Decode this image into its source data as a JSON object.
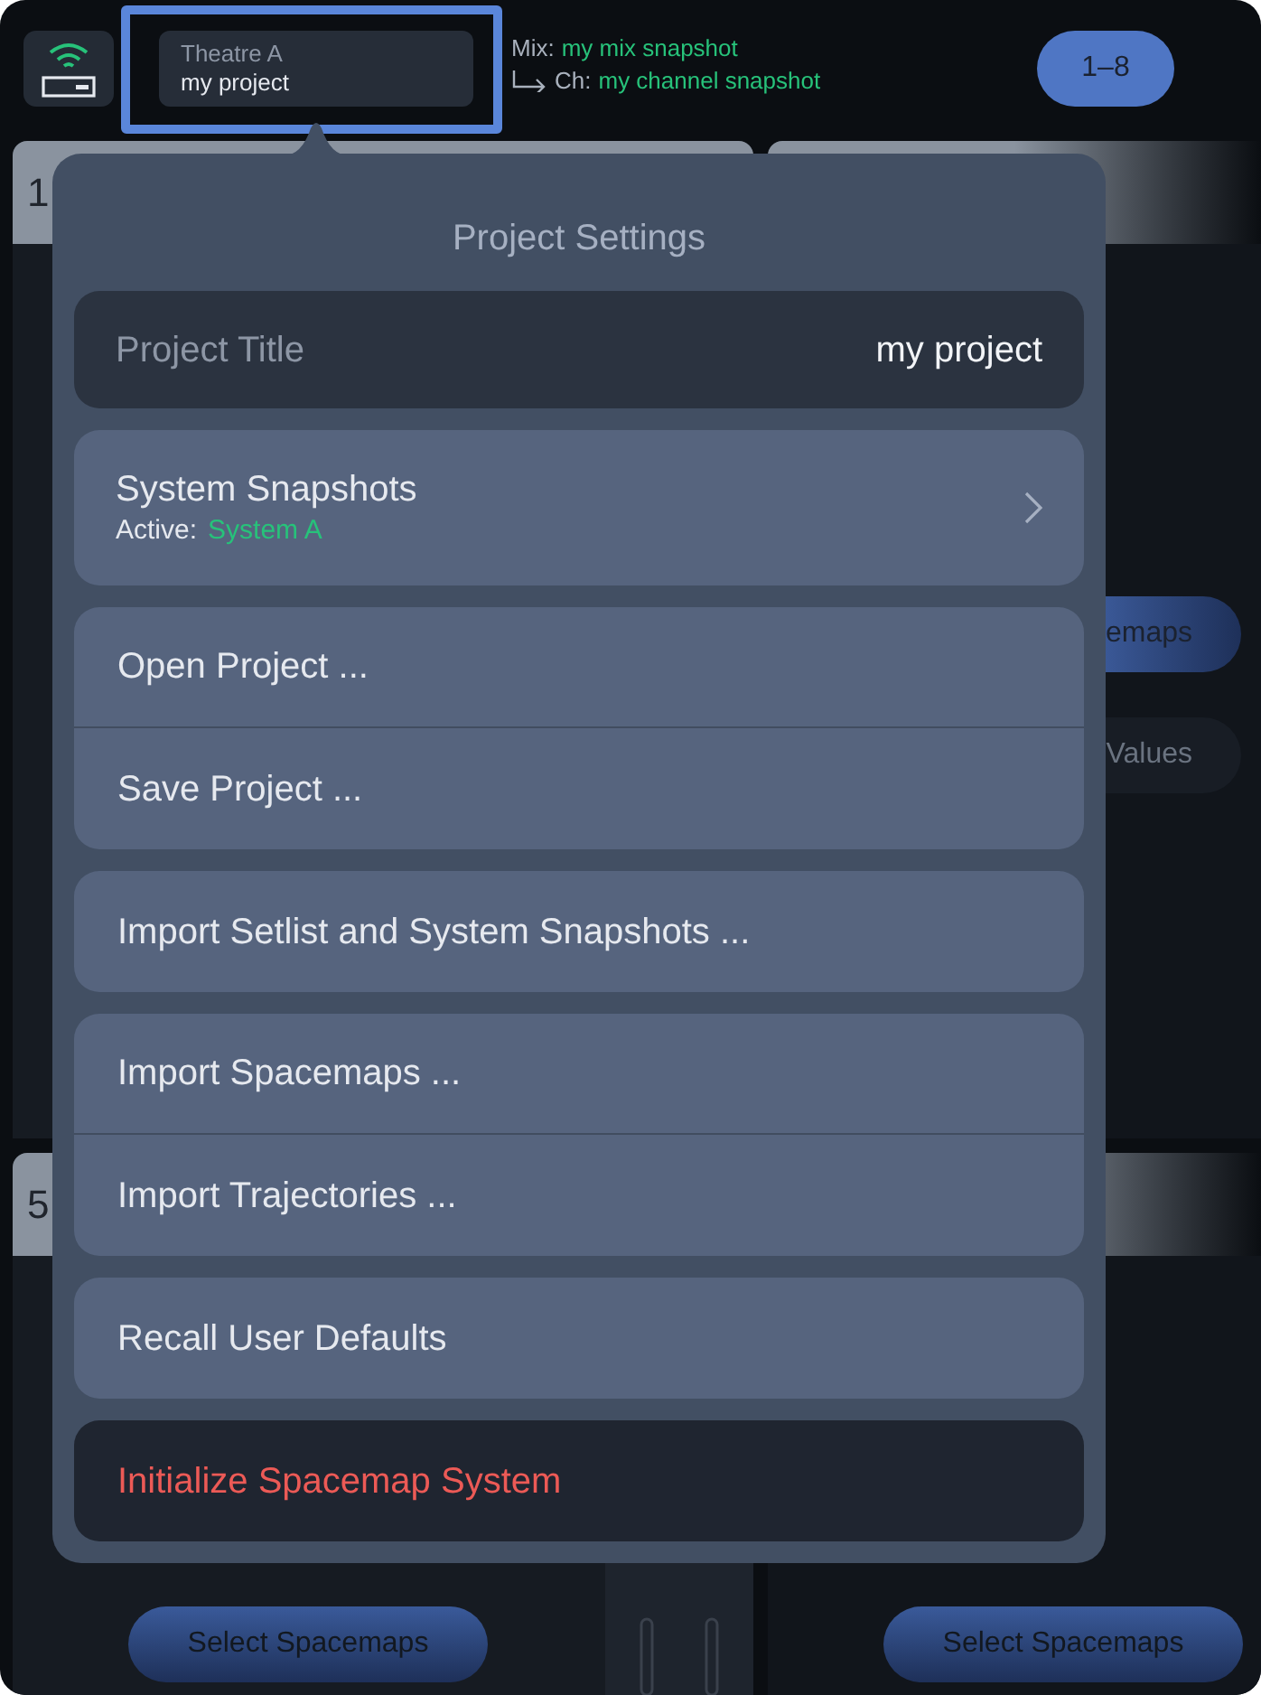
{
  "top_bar": {
    "device_name": "Theatre A",
    "project_name": "my project",
    "mix_label": "Mix:",
    "mix_snapshot": "my mix snapshot",
    "channel_label": "Ch:",
    "channel_snapshot": "my channel snapshot",
    "bank_button": "1–8"
  },
  "background": {
    "upper_panel_label": "1",
    "lower_panel_label": "5",
    "side_buttons": [
      {
        "label": "emaps",
        "selected": true
      },
      {
        "label": "Values",
        "selected": false
      }
    ],
    "bottom_buttons": [
      "Select Spacemaps",
      "Select Spacemaps"
    ]
  },
  "popover": {
    "title": "Project Settings",
    "project_title": {
      "label": "Project Title",
      "value": "my project"
    },
    "groups": [
      {
        "items": [
          {
            "kind": "nav",
            "label": "System Snapshots",
            "sublabel": "Active:",
            "subvalue": "System A"
          }
        ]
      },
      {
        "items": [
          {
            "kind": "action",
            "label": "Open Project ..."
          },
          {
            "kind": "action",
            "label": "Save Project ..."
          }
        ]
      },
      {
        "items": [
          {
            "kind": "action",
            "label": "Import Setlist and System Snapshots ..."
          }
        ]
      },
      {
        "items": [
          {
            "kind": "action",
            "label": "Import Spacemaps ..."
          },
          {
            "kind": "action",
            "label": "Import Trajectories ..."
          }
        ]
      },
      {
        "items": [
          {
            "kind": "action",
            "label": "Recall User Defaults"
          }
        ]
      },
      {
        "items": [
          {
            "kind": "destructive",
            "label": "Initialize Spacemap System"
          }
        ]
      }
    ]
  }
}
